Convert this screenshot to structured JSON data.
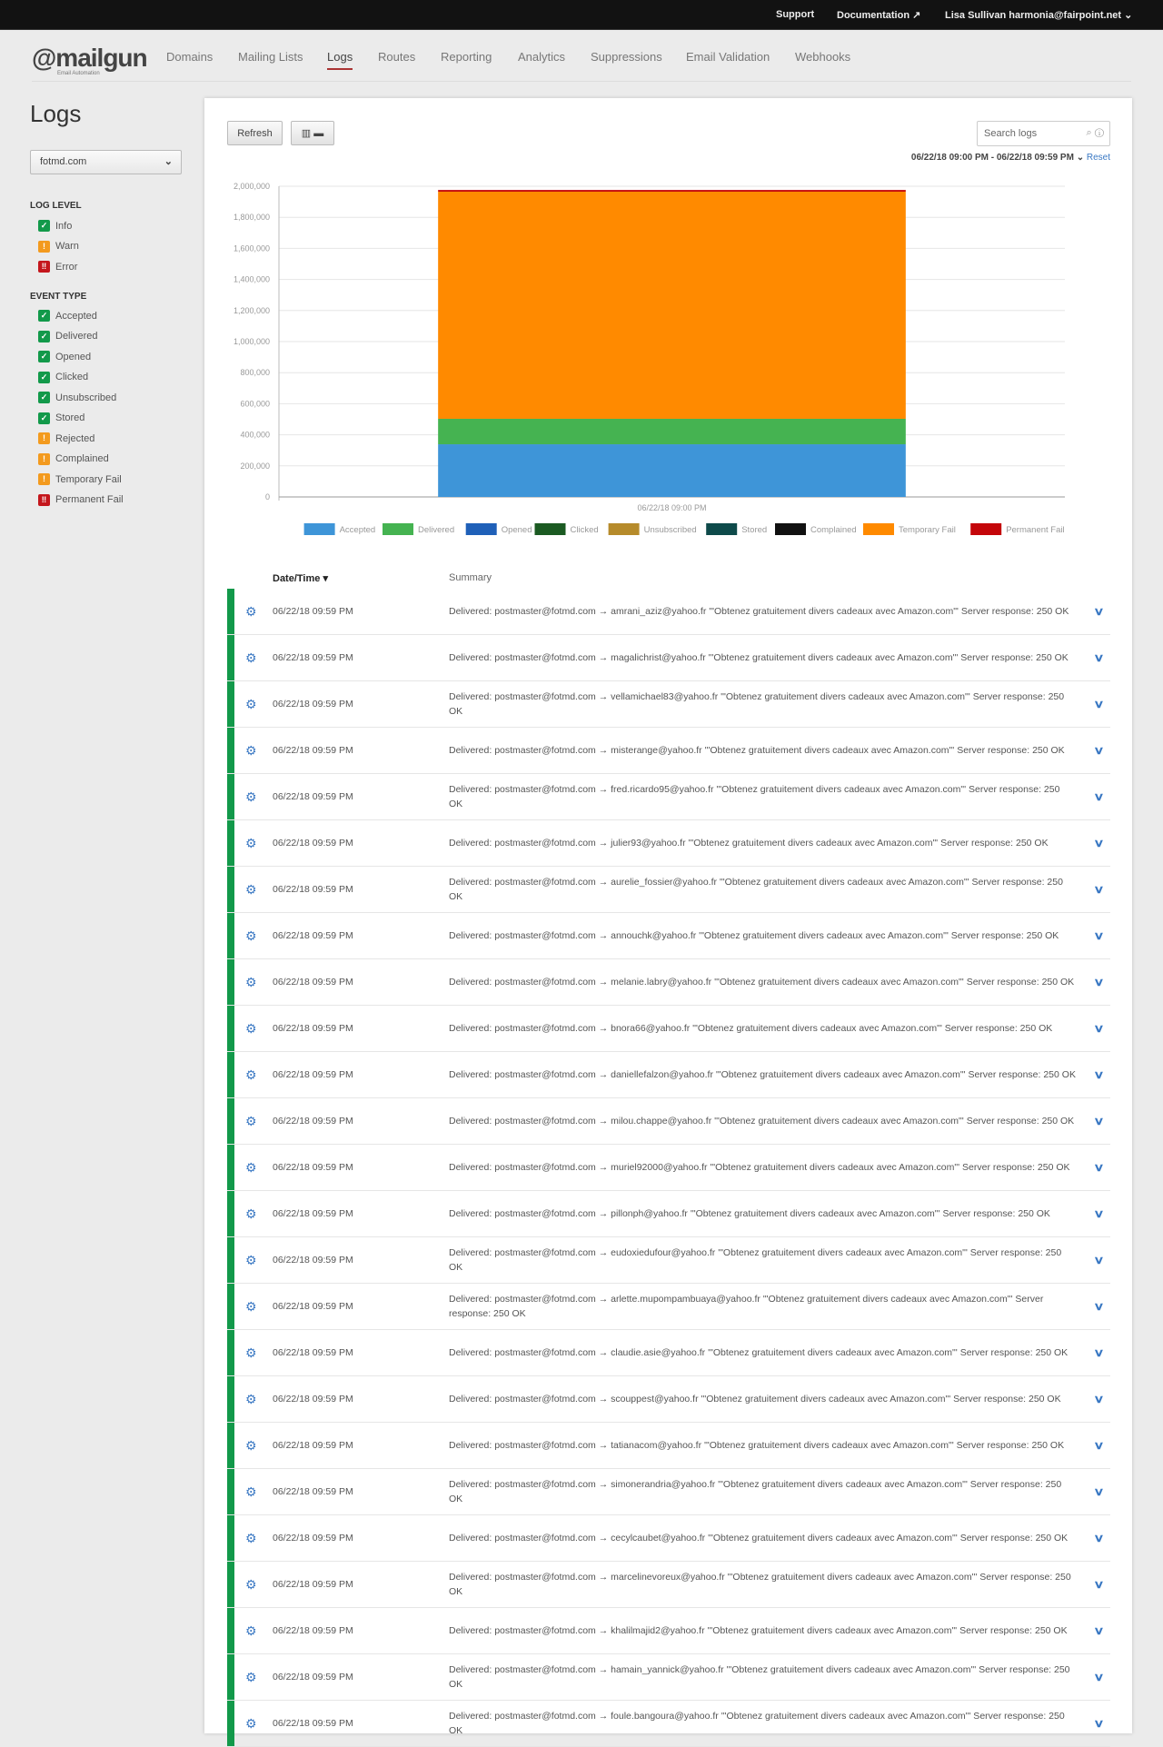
{
  "topbar": {
    "support": "Support",
    "documentation": "Documentation",
    "user": "Lisa Sullivan harmonia@fairpoint.net"
  },
  "logo": {
    "text": "@mailgun",
    "tagline": "Email Automation"
  },
  "nav": [
    {
      "label": "Domains"
    },
    {
      "label": "Mailing Lists"
    },
    {
      "label": "Logs",
      "active": true
    },
    {
      "label": "Routes"
    },
    {
      "label": "Reporting"
    },
    {
      "label": "Analytics"
    },
    {
      "label": "Suppressions"
    },
    {
      "label": "Email Validation"
    },
    {
      "label": "Webhooks"
    }
  ],
  "page_title": "Logs",
  "sidebar": {
    "domain": "fotmd.com",
    "log_level_title": "LOG LEVEL",
    "log_levels": [
      {
        "label": "Info",
        "status": "check"
      },
      {
        "label": "Warn",
        "status": "warn"
      },
      {
        "label": "Error",
        "status": "error"
      }
    ],
    "event_type_title": "EVENT TYPE",
    "event_types": [
      {
        "label": "Accepted",
        "status": "check"
      },
      {
        "label": "Delivered",
        "status": "check"
      },
      {
        "label": "Opened",
        "status": "check"
      },
      {
        "label": "Clicked",
        "status": "check"
      },
      {
        "label": "Unsubscribed",
        "status": "check"
      },
      {
        "label": "Stored",
        "status": "check"
      },
      {
        "label": "Rejected",
        "status": "warn"
      },
      {
        "label": "Complained",
        "status": "warn"
      },
      {
        "label": "Temporary Fail",
        "status": "warn"
      },
      {
        "label": "Permanent Fail",
        "status": "error"
      }
    ]
  },
  "status_colors": {
    "check": "#12994a",
    "warn": "#f39a1e",
    "error": "#c4161c"
  },
  "toolbar": {
    "refresh": "Refresh",
    "chart_toggle_icon": "bar-chart-icon",
    "search_placeholder": "Search logs",
    "date_range": "06/22/18 09:00 PM - 06/22/18 09:59 PM",
    "reset": "Reset"
  },
  "chart_data": {
    "type": "bar",
    "stacked": true,
    "categories": [
      "06/22/18 09:00 PM"
    ],
    "ylim": [
      0,
      2000000
    ],
    "yticks": [
      "0",
      "200,000",
      "400,000",
      "600,000",
      "800,000",
      "1,000,000",
      "1,200,000",
      "1,400,000",
      "1,600,000",
      "1,800,000",
      "2,000,000"
    ],
    "grid": true,
    "legend": "bottom",
    "series": [
      {
        "name": "Accepted",
        "color": "#3e95d8",
        "values": [
          339000
        ]
      },
      {
        "name": "Delivered",
        "color": "#45b351",
        "values": [
          164000
        ]
      },
      {
        "name": "Opened",
        "color": "#1f60b8",
        "values": [
          0
        ]
      },
      {
        "name": "Clicked",
        "color": "#1b5a22",
        "values": [
          0
        ]
      },
      {
        "name": "Unsubscribed",
        "color": "#b68b2b",
        "values": [
          0
        ]
      },
      {
        "name": "Stored",
        "color": "#0e4a4a",
        "values": [
          0
        ]
      },
      {
        "name": "Complained",
        "color": "#111111",
        "values": [
          0
        ]
      },
      {
        "name": "Temporary Fail",
        "color": "#ff8a00",
        "values": [
          1462000
        ]
      },
      {
        "name": "Permanent Fail",
        "color": "#c4060a",
        "values": [
          11000
        ]
      }
    ]
  },
  "table": {
    "headers": {
      "datetime": "Date/Time",
      "summary": "Summary"
    },
    "rows": [
      {
        "time": "06/22/18 09:59 PM",
        "summary": "Delivered: postmaster@fotmd.com → amrani_aziz@yahoo.fr '\"Obtenez gratuitement divers cadeaux avec Amazon.com\"' Server response: 250 OK"
      },
      {
        "time": "06/22/18 09:59 PM",
        "summary": "Delivered: postmaster@fotmd.com → magalichrist@yahoo.fr '\"Obtenez gratuitement divers cadeaux avec Amazon.com\"' Server response: 250 OK"
      },
      {
        "time": "06/22/18 09:59 PM",
        "summary": "Delivered: postmaster@fotmd.com → vellamichael83@yahoo.fr '\"Obtenez gratuitement divers cadeaux avec Amazon.com\"' Server response: 250 OK"
      },
      {
        "time": "06/22/18 09:59 PM",
        "summary": "Delivered: postmaster@fotmd.com → misterange@yahoo.fr '\"Obtenez gratuitement divers cadeaux avec Amazon.com\"' Server response: 250 OK"
      },
      {
        "time": "06/22/18 09:59 PM",
        "summary": "Delivered: postmaster@fotmd.com → fred.ricardo95@yahoo.fr '\"Obtenez gratuitement divers cadeaux avec Amazon.com\"' Server response: 250 OK"
      },
      {
        "time": "06/22/18 09:59 PM",
        "summary": "Delivered: postmaster@fotmd.com → julier93@yahoo.fr '\"Obtenez gratuitement divers cadeaux avec Amazon.com\"' Server response: 250 OK"
      },
      {
        "time": "06/22/18 09:59 PM",
        "summary": "Delivered: postmaster@fotmd.com → aurelie_fossier@yahoo.fr '\"Obtenez gratuitement divers cadeaux avec Amazon.com\"' Server response: 250 OK"
      },
      {
        "time": "06/22/18 09:59 PM",
        "summary": "Delivered: postmaster@fotmd.com → annouchk@yahoo.fr '\"Obtenez gratuitement divers cadeaux avec Amazon.com\"' Server response: 250 OK"
      },
      {
        "time": "06/22/18 09:59 PM",
        "summary": "Delivered: postmaster@fotmd.com → melanie.labry@yahoo.fr '\"Obtenez gratuitement divers cadeaux avec Amazon.com\"' Server response: 250 OK"
      },
      {
        "time": "06/22/18 09:59 PM",
        "summary": "Delivered: postmaster@fotmd.com → bnora66@yahoo.fr '\"Obtenez gratuitement divers cadeaux avec Amazon.com\"' Server response: 250 OK"
      },
      {
        "time": "06/22/18 09:59 PM",
        "summary": "Delivered: postmaster@fotmd.com → daniellefalzon@yahoo.fr '\"Obtenez gratuitement divers cadeaux avec Amazon.com\"' Server response: 250 OK"
      },
      {
        "time": "06/22/18 09:59 PM",
        "summary": "Delivered: postmaster@fotmd.com → milou.chappe@yahoo.fr '\"Obtenez gratuitement divers cadeaux avec Amazon.com\"' Server response: 250 OK"
      },
      {
        "time": "06/22/18 09:59 PM",
        "summary": "Delivered: postmaster@fotmd.com → muriel92000@yahoo.fr '\"Obtenez gratuitement divers cadeaux avec Amazon.com\"' Server response: 250 OK"
      },
      {
        "time": "06/22/18 09:59 PM",
        "summary": "Delivered: postmaster@fotmd.com → pillonph@yahoo.fr '\"Obtenez gratuitement divers cadeaux avec Amazon.com\"' Server response: 250 OK"
      },
      {
        "time": "06/22/18 09:59 PM",
        "summary": "Delivered: postmaster@fotmd.com → eudoxiedufour@yahoo.fr '\"Obtenez gratuitement divers cadeaux avec Amazon.com\"' Server response: 250 OK"
      },
      {
        "time": "06/22/18 09:59 PM",
        "summary": "Delivered: postmaster@fotmd.com → arlette.mupompambuaya@yahoo.fr '\"Obtenez gratuitement divers cadeaux avec Amazon.com\"' Server response: 250 OK"
      },
      {
        "time": "06/22/18 09:59 PM",
        "summary": "Delivered: postmaster@fotmd.com → claudie.asie@yahoo.fr '\"Obtenez gratuitement divers cadeaux avec Amazon.com\"' Server response: 250 OK"
      },
      {
        "time": "06/22/18 09:59 PM",
        "summary": "Delivered: postmaster@fotmd.com → scouppest@yahoo.fr '\"Obtenez gratuitement divers cadeaux avec Amazon.com\"' Server response: 250 OK"
      },
      {
        "time": "06/22/18 09:59 PM",
        "summary": "Delivered: postmaster@fotmd.com → tatianacom@yahoo.fr '\"Obtenez gratuitement divers cadeaux avec Amazon.com\"' Server response: 250 OK"
      },
      {
        "time": "06/22/18 09:59 PM",
        "summary": "Delivered: postmaster@fotmd.com → simonerandria@yahoo.fr '\"Obtenez gratuitement divers cadeaux avec Amazon.com\"' Server response: 250 OK"
      },
      {
        "time": "06/22/18 09:59 PM",
        "summary": "Delivered: postmaster@fotmd.com → cecylcaubet@yahoo.fr '\"Obtenez gratuitement divers cadeaux avec Amazon.com\"' Server response: 250 OK"
      },
      {
        "time": "06/22/18 09:59 PM",
        "summary": "Delivered: postmaster@fotmd.com → marcelinevoreux@yahoo.fr '\"Obtenez gratuitement divers cadeaux avec Amazon.com\"' Server response: 250 OK"
      },
      {
        "time": "06/22/18 09:59 PM",
        "summary": "Delivered: postmaster@fotmd.com → khalilmajid2@yahoo.fr '\"Obtenez gratuitement divers cadeaux avec Amazon.com\"' Server response: 250 OK"
      },
      {
        "time": "06/22/18 09:59 PM",
        "summary": "Delivered: postmaster@fotmd.com → hamain_yannick@yahoo.fr '\"Obtenez gratuitement divers cadeaux avec Amazon.com\"' Server response: 250 OK"
      },
      {
        "time": "06/22/18 09:59 PM",
        "summary": "Delivered: postmaster@fotmd.com → foule.bangoura@yahoo.fr '\"Obtenez gratuitement divers cadeaux avec Amazon.com\"' Server response: 250 OK"
      }
    ]
  }
}
